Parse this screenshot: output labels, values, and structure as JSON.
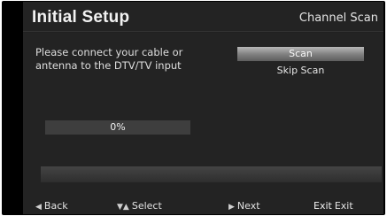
{
  "header": {
    "title": "Initial Setup",
    "screen_name": "Channel Scan"
  },
  "message": {
    "line1": "Please connect your cable or",
    "line2": "antenna to the DTV/TV input"
  },
  "menu": {
    "items": [
      {
        "label": "Scan",
        "selected": true
      },
      {
        "label": "Skip Scan",
        "selected": false
      }
    ]
  },
  "progress": {
    "value_percent": 0,
    "label": "0%"
  },
  "status": {
    "text": ""
  },
  "footer": {
    "back": {
      "icon": "left-arrow-icon",
      "label": "Back"
    },
    "select": {
      "icon": "up-down-arrows-icon",
      "label": "Select"
    },
    "next": {
      "icon": "right-arrow-icon",
      "label": "Next"
    },
    "exit": {
      "key": "Exit",
      "label": "Exit"
    }
  },
  "colors": {
    "panel_bg": "#232323",
    "selected_item": "#8a8a8a",
    "text": "#e8e8e8"
  }
}
